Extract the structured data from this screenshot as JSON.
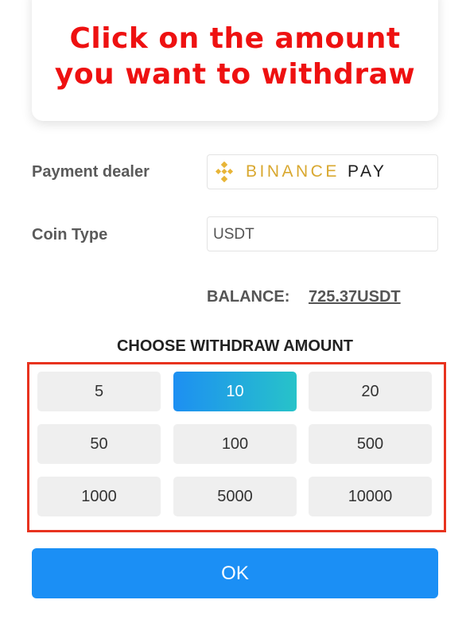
{
  "instruction": {
    "line1": "Click on the amount",
    "line2": "you want to withdraw",
    "color": "#ee1111"
  },
  "payment_dealer": {
    "label": "Payment dealer",
    "logo_icon": "binance-logo-icon",
    "brand_word": "BINANCE",
    "brand_pay": "PAY"
  },
  "coin_type": {
    "label": "Coin Type",
    "value": "USDT"
  },
  "balance": {
    "label": "BALANCE:",
    "value": "725.37USDT"
  },
  "withdraw": {
    "title": "CHOOSE WITHDRAW AMOUNT",
    "amounts": [
      "5",
      "10",
      "20",
      "50",
      "100",
      "500",
      "1000",
      "5000",
      "10000"
    ],
    "selected": "10",
    "highlight_color": "#e8331f"
  },
  "ok_button": {
    "label": "OK",
    "color": "#1b8ff5"
  }
}
